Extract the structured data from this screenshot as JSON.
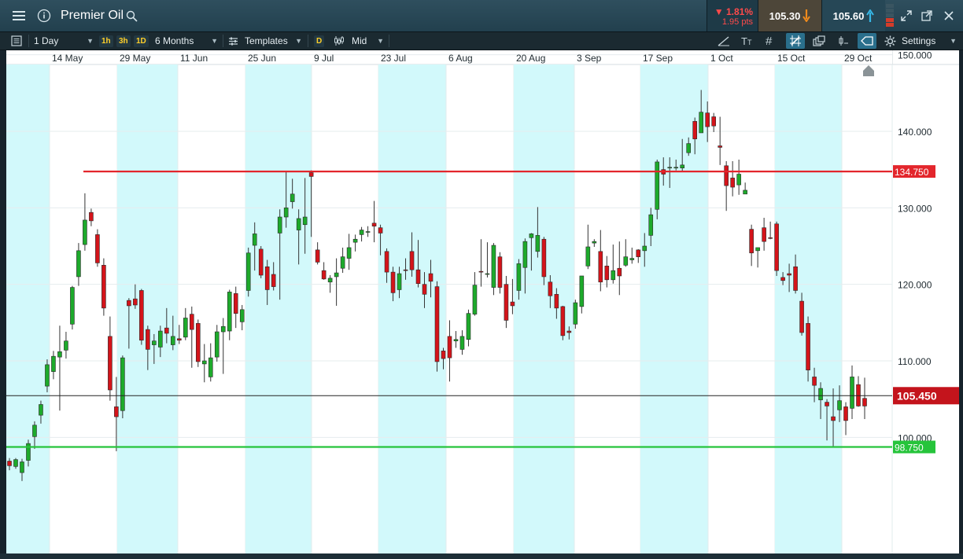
{
  "header": {
    "title": "Premier Oil",
    "change_pct": "▼ 1.81%",
    "change_pts": "1.95 pts",
    "sell_price": "105.30",
    "buy_price": "105.60"
  },
  "icons": [
    "menu-icon",
    "info-icon",
    "search-icon",
    "sell-arrow-down-icon",
    "buy-arrow-up-icon",
    "expand-icon",
    "popout-icon",
    "close-icon",
    "list-icon",
    "templates-icon",
    "candle-type-icon",
    "line-tool-icon",
    "text-tool-icon",
    "grid-icon",
    "crosshair-icon",
    "layers-icon",
    "indicator-icon",
    "price-label-icon",
    "settings-gear-icon"
  ],
  "toolbar": {
    "interval": "1 Day",
    "quick_1h": "1h",
    "quick_3h": "3h",
    "quick_1d": "1D",
    "range": "6 Months",
    "templates": "Templates",
    "d_tag": "D",
    "price_type": "Mid",
    "settings": "Settings"
  },
  "colors": {
    "up": "#1daa2b",
    "down": "#d4141a",
    "resistance": "#e3262c",
    "support": "#26c43b",
    "band": "#d2f9fb",
    "current": "#c4141c"
  },
  "chart_data": {
    "type": "candlestick",
    "instrument": "Premier Oil",
    "x_tick_labels": [
      "14 May",
      "29 May",
      "11 Jun",
      "25 Jun",
      "9 Jul",
      "23 Jul",
      "6 Aug",
      "20 Aug",
      "3 Sep",
      "17 Sep",
      "1 Oct",
      "15 Oct",
      "29 Oct"
    ],
    "y_tick_labels": [
      "150.000",
      "140.000",
      "130.000",
      "120.000",
      "110.000",
      "100.000"
    ],
    "ylim": [
      93,
      151
    ],
    "horizontal_lines": [
      {
        "label": "134.750",
        "value": 134.75,
        "color": "#e3262c"
      },
      {
        "label": "105.450",
        "value": 105.45,
        "color": "#222222",
        "current_price": true
      },
      {
        "label": "98.750",
        "value": 98.75,
        "color": "#26c43b"
      }
    ],
    "candles": [
      [
        96.9,
        96.3,
        97.3,
        95.7
      ],
      [
        96.2,
        97.1,
        97.3,
        95.9
      ],
      [
        95.4,
        96.8,
        97.2,
        94.3
      ],
      [
        97.0,
        99.2,
        99.7,
        96.2
      ],
      [
        100.1,
        101.6,
        102.1,
        98.5
      ],
      [
        102.9,
        104.3,
        104.8,
        101.8
      ],
      [
        106.7,
        109.5,
        110.2,
        105.9
      ],
      [
        108.6,
        110.6,
        111.3,
        107.6
      ],
      [
        110.5,
        111.2,
        114.6,
        103.5
      ],
      [
        111.4,
        112.6,
        113.8,
        110.3
      ],
      [
        114.8,
        119.6,
        119.8,
        114.1
      ],
      [
        121.0,
        124.4,
        125.4,
        119.8
      ],
      [
        125.2,
        128.4,
        131.9,
        124.4
      ],
      [
        129.4,
        128.3,
        129.9,
        127.6
      ],
      [
        126.5,
        122.8,
        127.2,
        122.3
      ],
      [
        122.5,
        116.9,
        123.4,
        115.9
      ],
      [
        113.2,
        106.2,
        115.8,
        104.8
      ],
      [
        104.0,
        102.7,
        107.9,
        98.2
      ],
      [
        103.5,
        110.4,
        110.7,
        102.5
      ],
      [
        117.9,
        117.2,
        118.2,
        111.6
      ],
      [
        118.1,
        117.3,
        120.0,
        116.8
      ],
      [
        119.2,
        112.7,
        119.4,
        112.1
      ],
      [
        114.1,
        111.5,
        114.6,
        108.8
      ],
      [
        112.1,
        112.6,
        113.5,
        109.6
      ],
      [
        111.8,
        113.9,
        114.6,
        110.5
      ],
      [
        114.3,
        113.6,
        116.9,
        112.3
      ],
      [
        112.1,
        113.2,
        115.9,
        111.4
      ],
      [
        112.9,
        112.7,
        114.7,
        112.2
      ],
      [
        113.1,
        115.6,
        116.9,
        112.7
      ],
      [
        116.1,
        114.1,
        117.1,
        109.1
      ],
      [
        114.9,
        109.9,
        115.4,
        109.2
      ],
      [
        109.6,
        110.0,
        112.2,
        107.2
      ],
      [
        107.9,
        110.4,
        112.3,
        107.3
      ],
      [
        110.5,
        113.8,
        114.7,
        109.9
      ],
      [
        113.8,
        114.5,
        115.6,
        108.3
      ],
      [
        113.9,
        119.0,
        119.3,
        112.7
      ],
      [
        118.8,
        116.2,
        119.7,
        114.3
      ],
      [
        115.1,
        116.7,
        117.3,
        114.0
      ],
      [
        119.2,
        124.1,
        124.8,
        118.4
      ],
      [
        125.1,
        126.6,
        128.1,
        121.8
      ],
      [
        124.6,
        121.2,
        125.0,
        120.8
      ],
      [
        122.3,
        119.3,
        123.2,
        117.3
      ],
      [
        121.3,
        119.7,
        122.9,
        119.2
      ],
      [
        126.7,
        128.8,
        129.8,
        118.0
      ],
      [
        128.8,
        130.0,
        134.7,
        127.4
      ],
      [
        130.8,
        131.8,
        133.8,
        129.9
      ],
      [
        127.1,
        128.6,
        129.8,
        122.6
      ],
      [
        127.8,
        128.8,
        133.9,
        124.0
      ],
      [
        134.6,
        134.1,
        134.9,
        126.2
      ],
      [
        124.5,
        122.9,
        125.5,
        122.6
      ],
      [
        121.8,
        120.7,
        122.9,
        120.6
      ],
      [
        120.3,
        120.8,
        121.2,
        118.9
      ],
      [
        121.0,
        121.5,
        123.4,
        117.2
      ],
      [
        122.1,
        123.6,
        124.8,
        121.5
      ],
      [
        123.4,
        124.8,
        126.6,
        121.9
      ],
      [
        125.5,
        125.9,
        126.5,
        124.3
      ],
      [
        126.5,
        127.1,
        127.5,
        125.6
      ],
      [
        126.8,
        126.9,
        127.6,
        126.2
      ],
      [
        128.0,
        127.6,
        130.9,
        125.5
      ],
      [
        127.4,
        126.7,
        127.8,
        123.8
      ],
      [
        124.3,
        121.6,
        124.7,
        120.2
      ],
      [
        121.6,
        118.9,
        122.3,
        117.8
      ],
      [
        119.3,
        121.4,
        122.3,
        118.2
      ],
      [
        121.9,
        121.8,
        123.4,
        120.6
      ],
      [
        124.3,
        121.9,
        126.8,
        121.0
      ],
      [
        121.9,
        120.1,
        125.8,
        119.6
      ],
      [
        120.0,
        118.7,
        121.6,
        116.9
      ],
      [
        121.4,
        120.4,
        123.2,
        118.3
      ],
      [
        119.7,
        109.9,
        120.4,
        108.6
      ],
      [
        111.3,
        110.3,
        111.7,
        108.9
      ],
      [
        113.2,
        110.4,
        115.3,
        107.3
      ],
      [
        112.6,
        112.8,
        113.9,
        111.7
      ],
      [
        111.5,
        113.2,
        114.0,
        110.8
      ],
      [
        112.8,
        116.2,
        116.7,
        111.9
      ],
      [
        116.1,
        119.9,
        121.6,
        115.9
      ],
      [
        121.7,
        121.6,
        125.9,
        119.7
      ],
      [
        121.4,
        121.4,
        125.5,
        120.9
      ],
      [
        119.6,
        125.1,
        125.4,
        118.6
      ],
      [
        123.6,
        119.6,
        124.2,
        118.8
      ],
      [
        120.0,
        115.3,
        121.1,
        114.3
      ],
      [
        117.7,
        117.2,
        120.7,
        116.1
      ],
      [
        119.2,
        122.7,
        123.3,
        118.0
      ],
      [
        122.2,
        125.6,
        126.0,
        118.8
      ],
      [
        126.1,
        126.6,
        126.7,
        121.8
      ],
      [
        124.3,
        126.4,
        130.1,
        123.5
      ],
      [
        125.9,
        121.0,
        126.2,
        119.9
      ],
      [
        120.3,
        118.5,
        121.2,
        116.9
      ],
      [
        118.7,
        116.9,
        119.5,
        115.5
      ],
      [
        117.1,
        113.3,
        117.2,
        112.7
      ],
      [
        113.9,
        113.7,
        114.5,
        112.8
      ],
      [
        114.8,
        117.6,
        118.0,
        114.2
      ],
      [
        117.1,
        121.1,
        121.1,
        116.2
      ],
      [
        122.4,
        124.9,
        127.8,
        122.0
      ],
      [
        125.4,
        125.6,
        125.9,
        124.9
      ],
      [
        124.3,
        120.3,
        127.1,
        119.1
      ],
      [
        122.4,
        120.6,
        123.7,
        119.6
      ],
      [
        120.6,
        121.8,
        125.2,
        120.1
      ],
      [
        122.1,
        121.1,
        125.6,
        118.6
      ],
      [
        122.5,
        123.6,
        125.9,
        122.3
      ],
      [
        123.2,
        123.4,
        124.8,
        122.7
      ],
      [
        124.5,
        123.6,
        124.6,
        122.8
      ],
      [
        124.4,
        125.0,
        126.7,
        122.3
      ],
      [
        126.4,
        129.1,
        130.0,
        125.0
      ],
      [
        129.8,
        136.0,
        136.3,
        128.5
      ],
      [
        135.0,
        134.4,
        136.6,
        132.9
      ],
      [
        135.3,
        135.3,
        136.6,
        132.6
      ],
      [
        135.3,
        135.3,
        136.3,
        134.9
      ],
      [
        135.2,
        135.6,
        139.0,
        134.8
      ],
      [
        137.2,
        138.4,
        139.2,
        136.8
      ],
      [
        141.3,
        139.0,
        141.8,
        137.0
      ],
      [
        139.8,
        142.5,
        145.4,
        139.9
      ],
      [
        142.4,
        140.6,
        143.9,
        138.6
      ],
      [
        141.9,
        140.7,
        142.4,
        139.9
      ],
      [
        138.1,
        137.9,
        141.9,
        135.6
      ],
      [
        135.5,
        132.9,
        136.1,
        129.6
      ],
      [
        133.9,
        132.7,
        136.1,
        131.5
      ],
      [
        133.0,
        134.4,
        136.3,
        131.7
      ],
      [
        131.8,
        132.3,
        133.3,
        131.8
      ],
      [
        127.2,
        124.1,
        127.8,
        122.4
      ],
      [
        124.4,
        124.8,
        124.8,
        122.2
      ],
      [
        127.4,
        125.6,
        128.7,
        124.4
      ],
      [
        126.1,
        126.0,
        128.2,
        125.9
      ],
      [
        127.9,
        121.8,
        128.2,
        121.1
      ],
      [
        120.9,
        120.5,
        121.6,
        119.9
      ],
      [
        121.4,
        121.2,
        122.7,
        119.0
      ],
      [
        122.3,
        119.2,
        123.9,
        118.8
      ],
      [
        117.8,
        113.7,
        118.9,
        113.3
      ],
      [
        114.9,
        108.8,
        115.8,
        107.3
      ],
      [
        107.9,
        106.8,
        109.1,
        104.6
      ],
      [
        104.9,
        106.4,
        107.2,
        102.4
      ],
      [
        104.6,
        104.1,
        105.0,
        99.6
      ],
      [
        102.7,
        102.2,
        106.4,
        98.8
      ],
      [
        103.6,
        104.8,
        106.8,
        102.0
      ],
      [
        104.0,
        102.2,
        104.6,
        100.3
      ],
      [
        103.8,
        107.9,
        109.4,
        102.4
      ],
      [
        106.9,
        104.1,
        108.0,
        104.0
      ],
      [
        105.1,
        104.1,
        107.8,
        102.4
      ]
    ]
  }
}
